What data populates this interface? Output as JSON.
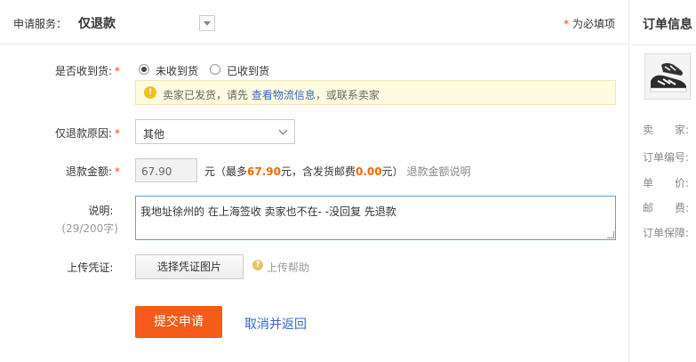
{
  "header": {
    "service_label": "申请服务：",
    "service_value": "仅退款",
    "required_star": "*",
    "required_note": "为必填项"
  },
  "form": {
    "received": {
      "label": "是否收到货:",
      "star": "*",
      "options": [
        "未收到货",
        "已收到货"
      ],
      "selected": "未收到货"
    },
    "notice": {
      "icon": "bulb-icon",
      "text_before": "卖家已发货，请先",
      "link": "查看物流信息",
      "text_after": "，或联系卖家"
    },
    "reason": {
      "label": "仅退款原因:",
      "star": "*",
      "value": "其他"
    },
    "amount": {
      "label": "退款金额:",
      "star": "*",
      "value": "67.90",
      "unit": "元（最多",
      "max": "67.90",
      "unit2": "元，含发货邮费",
      "shipping": "0.00",
      "unit3": "元）",
      "explain_link": "退款金额说明"
    },
    "description": {
      "label": "说明:",
      "counter": "(29/200字)",
      "value": "我地址徐州的 在上海签收  卖家也不在- -没回复 先退款"
    },
    "upload": {
      "label": "上传凭证:",
      "button": "选择凭证图片",
      "help": "上传帮助"
    },
    "actions": {
      "submit": "提交申请",
      "cancel": "取消并返回"
    }
  },
  "order_info": {
    "title": "订单信息",
    "rows": [
      "卖　　家:",
      "订单编号:",
      "单　　价:",
      "邮　　费:",
      "订单保障:"
    ]
  },
  "colors": {
    "accent": "#f45a1a",
    "link": "#3366cc",
    "amount_highlight": "#ff6600",
    "focus_border": "#5b9fd8"
  }
}
